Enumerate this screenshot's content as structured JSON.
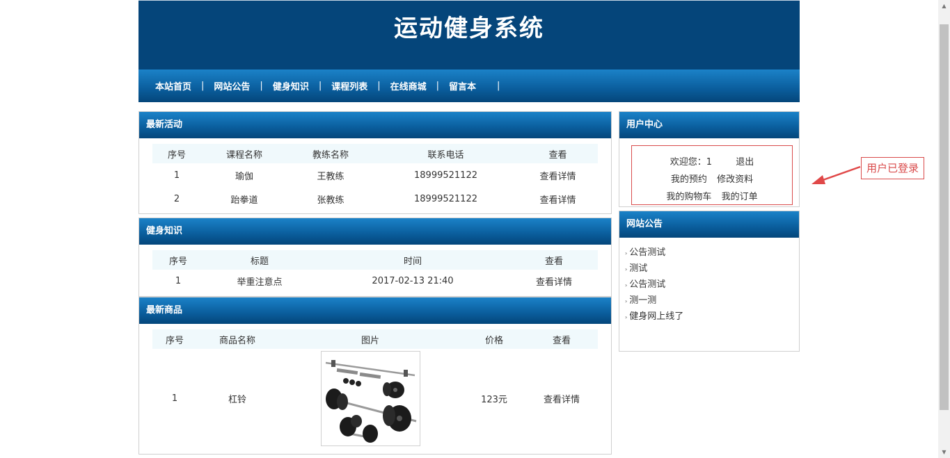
{
  "site_title": "运动健身系统",
  "nav": [
    "本站首页",
    "网站公告",
    "健身知识",
    "课程列表",
    "在线商城",
    "留言本"
  ],
  "activities": {
    "title": "最新活动",
    "headers": [
      "序号",
      "课程名称",
      "教练名称",
      "联系电话",
      "查看"
    ],
    "rows": [
      {
        "no": "1",
        "course": "瑜伽",
        "coach": "王教练",
        "phone": "18999521122",
        "view": "查看详情"
      },
      {
        "no": "2",
        "course": "跆拳道",
        "coach": "张教练",
        "phone": "18999521122",
        "view": "查看详情"
      }
    ]
  },
  "knowledge": {
    "title": "健身知识",
    "headers": [
      "序号",
      "标题",
      "时间",
      "查看"
    ],
    "rows": [
      {
        "no": "1",
        "title": "举重注意点",
        "time": "2017-02-13 21:40",
        "view": "查看详情"
      }
    ]
  },
  "products": {
    "title": "最新商品",
    "headers": [
      "序号",
      "商品名称",
      "图片",
      "价格",
      "查看"
    ],
    "rows": [
      {
        "no": "1",
        "name": "杠铃",
        "image": "barbell-dumbbell-set",
        "price": "123元",
        "view": "查看详情"
      }
    ]
  },
  "user_center": {
    "title": "用户中心",
    "welcome": "欢迎您：1",
    "logout": "退出",
    "my_booking": "我的预约",
    "edit_profile": "修改资料",
    "my_cart": "我的购物车",
    "my_orders": "我的订单"
  },
  "notices": {
    "title": "网站公告",
    "items": [
      "公告测试",
      "测试",
      "公告测试",
      "测一测",
      "健身网上线了"
    ]
  },
  "annotation": {
    "text": "用户已登录",
    "color": "#d94a4a"
  },
  "colors": {
    "banner": "#05457a",
    "header_bar": "#0a5d9c",
    "table_header_bg": "#f0f9fc"
  }
}
